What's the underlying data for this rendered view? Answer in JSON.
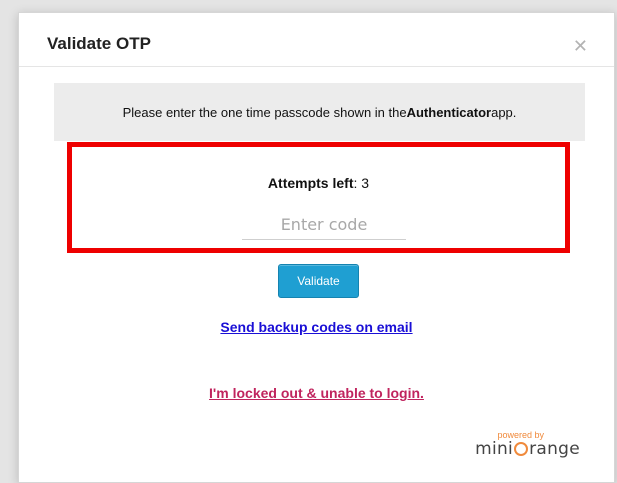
{
  "dialog": {
    "title": "Validate OTP",
    "close_icon": "close-icon"
  },
  "notice": {
    "prefix": "Please enter the one time passcode shown in the ",
    "app_name": "Authenticator",
    "suffix": " app."
  },
  "attempts": {
    "label": "Attempts left",
    "separator": ": ",
    "count": "3"
  },
  "code_input": {
    "value": "",
    "placeholder": "Enter code"
  },
  "actions": {
    "validate_label": "Validate",
    "backup_link": "Send backup codes on email",
    "locked_link": "I'm locked out & unable to login."
  },
  "branding": {
    "powered_by": "powered by",
    "logo_left": "mini",
    "logo_right": "range"
  },
  "colors": {
    "highlight_border": "#ee0000",
    "button_blue": "#1f9fd2",
    "backup_link": "#1a0fd6",
    "locked_link": "#c0245e",
    "brand_orange": "#f08a3c"
  }
}
